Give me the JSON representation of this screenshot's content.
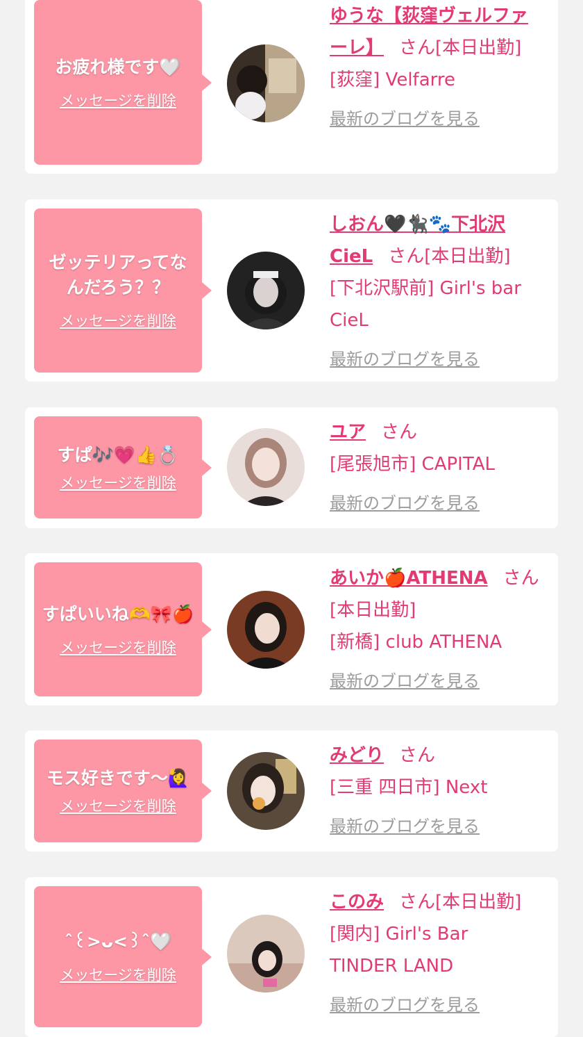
{
  "colors": {
    "accent": "#e23a72",
    "bubble": "#fd97a6",
    "background": "#f2f2f2",
    "card": "#ffffff",
    "link_gray": "#9c9c9c"
  },
  "delete_label": "メッセージを削除",
  "blog_label": "最新のブログを見る",
  "cards": [
    {
      "message": "お疲れ様です🤍",
      "name": "ゆうな【荻窪ヴェルファーレ】",
      "suffix": "さん[本日出勤]",
      "shop": "[荻窪] Velfarre"
    },
    {
      "message": "ゼッテリアってなんだろう？？",
      "name": "しおん🖤🐈‍⬛🐾下北沢CieL",
      "suffix": "さん[本日出勤]",
      "shop": "[下北沢駅前] Girl's bar CieL"
    },
    {
      "message": "すぱ🎶💗👍💍",
      "name": "ユア",
      "suffix": "さん",
      "shop": "[尾張旭市] CAPITAL"
    },
    {
      "message": "すぱいいね🫶🎀🍎",
      "name": "あいか🍎ATHENA",
      "suffix": "さん[本日出勤]",
      "shop": "[新橋] club ATHENA"
    },
    {
      "message": "モス好きです〜🙋‍♀️",
      "name": "みどり",
      "suffix": "さん",
      "shop": "[三重 四日市] Next"
    },
    {
      "message": "ˆ꒰>ᴗ<꒱ˆ🤍",
      "name": "このみ",
      "suffix": "さん[本日出勤]",
      "shop": "[関内] Girl's Bar TINDER LAND"
    }
  ]
}
